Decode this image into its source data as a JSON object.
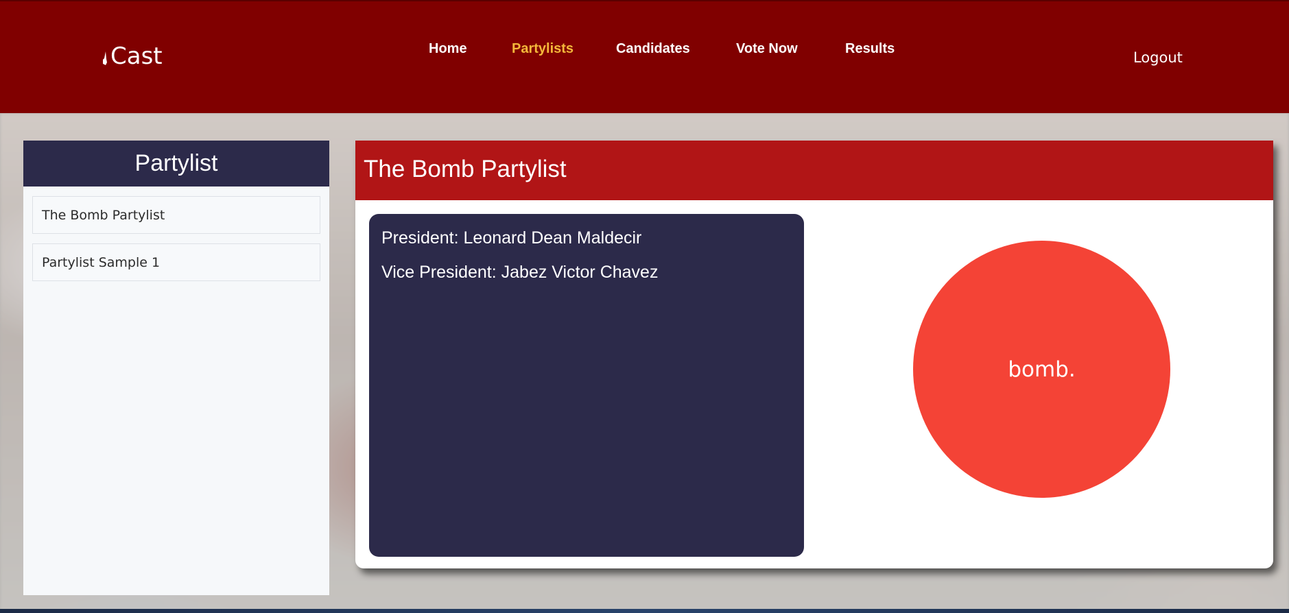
{
  "app": {
    "logo_text": "Cast"
  },
  "nav": {
    "items": [
      {
        "label": "Home"
      },
      {
        "label": "Partylists"
      },
      {
        "label": "Candidates"
      },
      {
        "label": "Vote Now"
      },
      {
        "label": "Results"
      }
    ],
    "active": "Partylists",
    "logout": "Logout"
  },
  "sidebar": {
    "title": "Partylist",
    "items": [
      {
        "label": "The Bomb Partylist"
      },
      {
        "label": "Partylist Sample 1"
      }
    ]
  },
  "partylist": {
    "name": "The Bomb Partylist",
    "president": "President: Leonard Dean Maldecir",
    "vice_president": "Vice President: Jabez Victor Chavez",
    "logo_text": "bomb."
  },
  "colors": {
    "header": "#800000",
    "nav_active": "#f4b73a",
    "sidebar_header": "#2c2a4a",
    "card_header": "#b11516",
    "logo_circle": "#f44336"
  }
}
